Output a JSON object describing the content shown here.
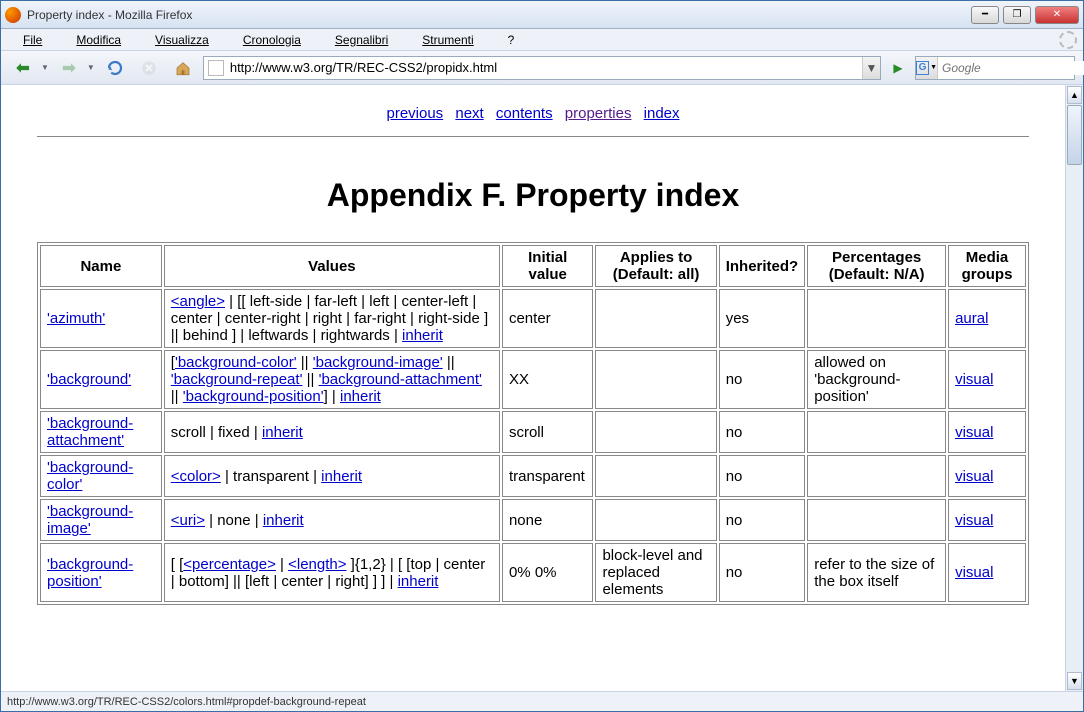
{
  "window": {
    "title": "Property index - Mozilla Firefox"
  },
  "menu": {
    "file": "File",
    "modifica": "Modifica",
    "visualizza": "Visualizza",
    "cronologia": "Cronologia",
    "segnalibri": "Segnalibri",
    "strumenti": "Strumenti",
    "help": "?"
  },
  "url": {
    "value": "http://www.w3.org/TR/REC-CSS2/propidx.html"
  },
  "search": {
    "placeholder": "Google"
  },
  "statusbar": {
    "text": "http://www.w3.org/TR/REC-CSS2/colors.html#propdef-background-repeat"
  },
  "nav": {
    "previous": "previous",
    "next": "next",
    "contents": "contents",
    "properties": "properties",
    "index": "index"
  },
  "heading": "Appendix F. Property index",
  "table": {
    "headers": [
      "Name",
      "Values",
      "Initial value",
      "Applies to (Default: all)",
      "Inherited?",
      "Percentages (Default: N/A)",
      "Media groups"
    ],
    "rows": [
      {
        "name": "'azimuth'",
        "values_parts": [
          {
            "t": "link",
            "v": "<angle>"
          },
          {
            "t": "text",
            "v": " | [[ left-side | far-left | left | center-left | center | center-right | right | far-right | right-side ] || behind ] | leftwards | rightwards | "
          },
          {
            "t": "link",
            "v": "inherit"
          }
        ],
        "initial": "center",
        "applies": "",
        "inherited": "yes",
        "percentages": "",
        "media": "aural"
      },
      {
        "name": "'background'",
        "values_parts": [
          {
            "t": "text",
            "v": "["
          },
          {
            "t": "link",
            "v": "'background-color'"
          },
          {
            "t": "text",
            "v": " || "
          },
          {
            "t": "link",
            "v": "'background-image'"
          },
          {
            "t": "text",
            "v": " || "
          },
          {
            "t": "link",
            "v": "'background-repeat'"
          },
          {
            "t": "text",
            "v": " || "
          },
          {
            "t": "link",
            "v": "'background-attachment'"
          },
          {
            "t": "text",
            "v": " || "
          },
          {
            "t": "link",
            "v": "'background-position'"
          },
          {
            "t": "text",
            "v": "] | "
          },
          {
            "t": "link",
            "v": "inherit"
          }
        ],
        "initial": "XX",
        "applies": "",
        "inherited": "no",
        "percentages": "allowed on 'background-position'",
        "media": "visual"
      },
      {
        "name": "'background-attachment'",
        "values_parts": [
          {
            "t": "text",
            "v": "scroll | fixed | "
          },
          {
            "t": "link",
            "v": "inherit"
          }
        ],
        "initial": "scroll",
        "applies": "",
        "inherited": "no",
        "percentages": "",
        "media": "visual"
      },
      {
        "name": "'background-color'",
        "values_parts": [
          {
            "t": "link",
            "v": "<color>"
          },
          {
            "t": "text",
            "v": " | transparent | "
          },
          {
            "t": "link",
            "v": "inherit"
          }
        ],
        "initial": "transparent",
        "applies": "",
        "inherited": "no",
        "percentages": "",
        "media": "visual"
      },
      {
        "name": "'background-image'",
        "values_parts": [
          {
            "t": "link",
            "v": "<uri>"
          },
          {
            "t": "text",
            "v": " | none | "
          },
          {
            "t": "link",
            "v": "inherit"
          }
        ],
        "initial": "none",
        "applies": "",
        "inherited": "no",
        "percentages": "",
        "media": "visual"
      },
      {
        "name": "'background-position'",
        "values_parts": [
          {
            "t": "text",
            "v": "[ ["
          },
          {
            "t": "link",
            "v": "<percentage>"
          },
          {
            "t": "text",
            "v": " | "
          },
          {
            "t": "link",
            "v": "<length>"
          },
          {
            "t": "text",
            "v": " ]{1,2} | [ [top | center | bottom] || [left | center | right] ] ] | "
          },
          {
            "t": "link",
            "v": "inherit"
          }
        ],
        "initial": "0% 0%",
        "applies": "block-level and replaced elements",
        "inherited": "no",
        "percentages": "refer to the size of the box itself",
        "media": "visual"
      }
    ]
  }
}
